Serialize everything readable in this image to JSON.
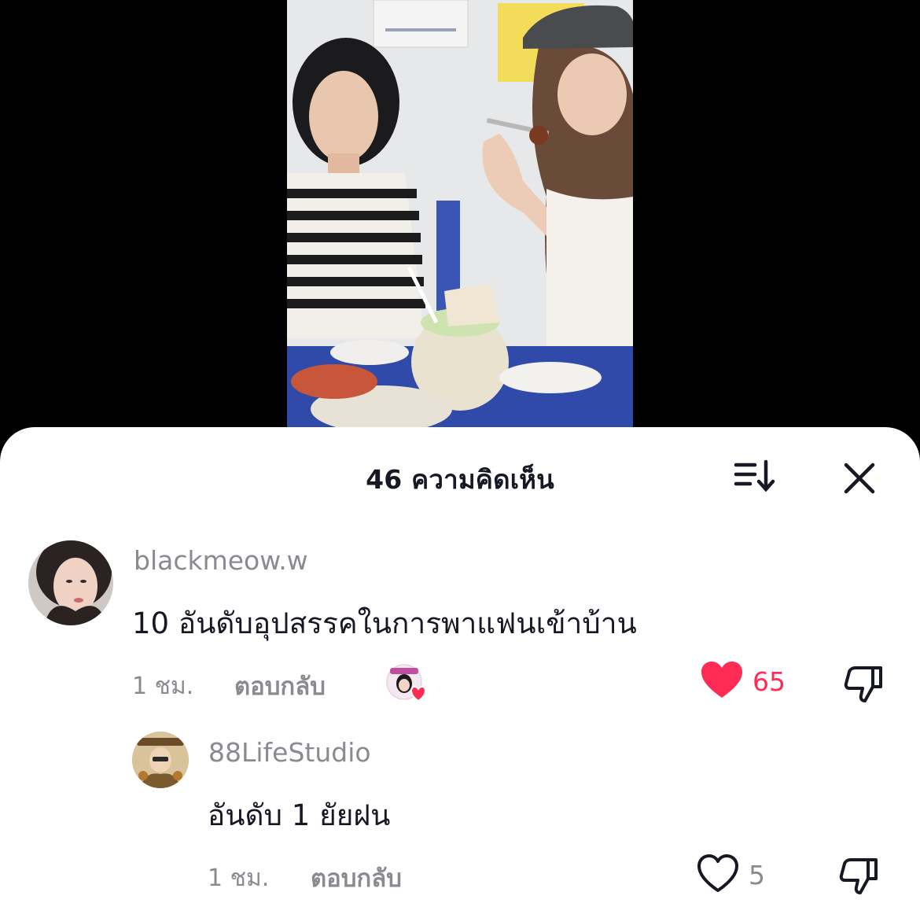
{
  "header": {
    "title": "46 ความคิดเห็น",
    "sort_icon": "sort-icon",
    "close_icon": "close-icon"
  },
  "comments": [
    {
      "username": "blackmeow.w",
      "text": "10 อันดับอุปสรรคในการพาแฟนเข้าบ้าน",
      "time": "1 ชม.",
      "reply_label": "ตอบกลับ",
      "likes": "65",
      "liked": true,
      "creator_liked_badge": true
    },
    {
      "username": "88LifeStudio",
      "text": "อันดับ 1 ยัยฝน",
      "time": "1 ชม.",
      "reply_label": "ตอบกลับ",
      "likes": "5",
      "liked": false
    }
  ],
  "colors": {
    "like_red": "#fe2c55",
    "secondary_text": "#8a8b91",
    "primary_text": "#161823"
  }
}
